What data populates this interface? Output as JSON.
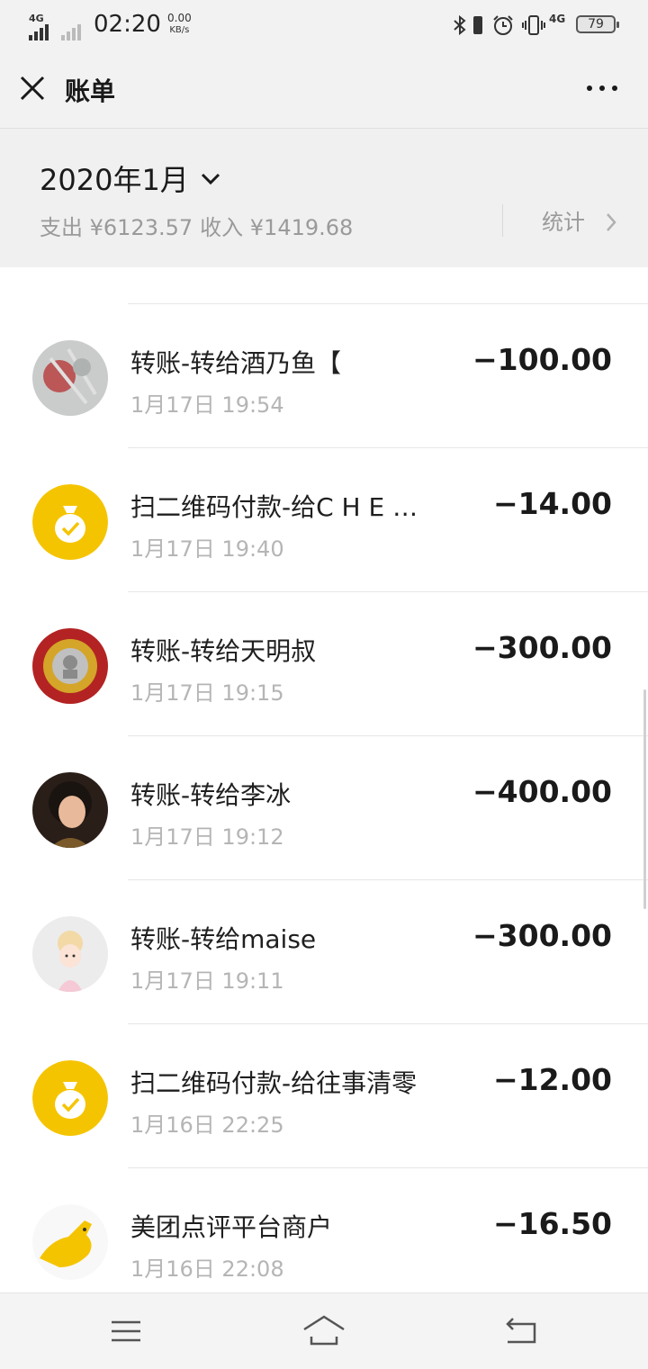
{
  "status_bar": {
    "network": "4G",
    "time": "02:20",
    "speed_value": "0.00",
    "speed_unit": "KB/s",
    "network2": "4G",
    "battery": "79"
  },
  "app_bar": {
    "title": "账单",
    "close_icon": "close-icon",
    "more_icon": "more-dots-icon"
  },
  "summary": {
    "month": "2020年1月",
    "expense": "支出 ¥6123.57",
    "income": "收入 ¥1419.68",
    "stats_label": "统计"
  },
  "transactions": [
    {
      "title": "转账-转给酒乃鱼【",
      "time": "1月17日 19:54",
      "amount": "−100.00",
      "avatar": "photo-avatar"
    },
    {
      "title": "扫二维码付款-给C H E …",
      "time": "1月17日 19:40",
      "amount": "−14.00",
      "avatar": "money-bag-icon"
    },
    {
      "title": "转账-转给天明叔",
      "time": "1月17日 19:15",
      "amount": "−300.00",
      "avatar": "badge-avatar"
    },
    {
      "title": "转账-转给李冰",
      "time": "1月17日 19:12",
      "amount": "−400.00",
      "avatar": "person-avatar"
    },
    {
      "title": "转账-转给maise",
      "time": "1月17日 19:11",
      "amount": "−300.00",
      "avatar": "cartoon-avatar"
    },
    {
      "title": "扫二维码付款-给往事清零",
      "time": "1月16日 22:25",
      "amount": "−12.00",
      "avatar": "money-bag-icon"
    },
    {
      "title": "美团点评平台商户",
      "time": "1月16日 22:08",
      "amount": "−16.50",
      "avatar": "kangaroo-logo"
    }
  ],
  "colors": {
    "money_bag_yellow": "#F5C400",
    "header_bg": "#f2f2f2",
    "muted_text": "#9a9a9a"
  },
  "nav_bar": {
    "menu_icon": "menu-icon",
    "home_icon": "home-icon",
    "back_icon": "back-icon"
  }
}
